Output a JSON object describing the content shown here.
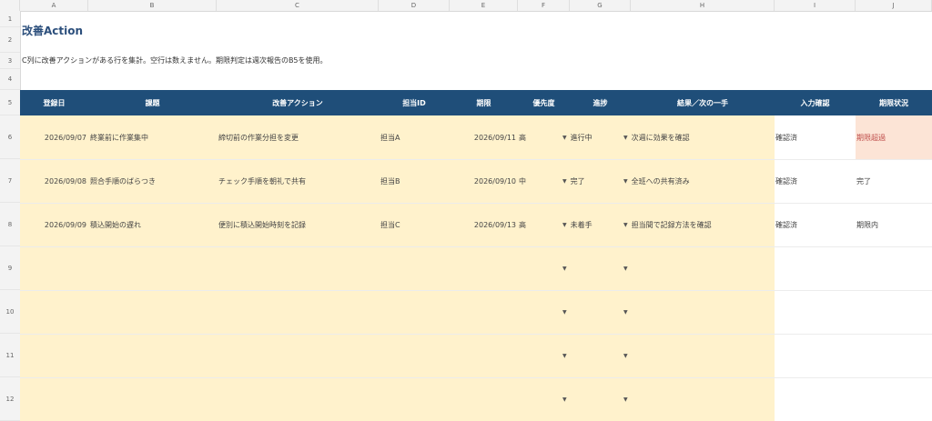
{
  "columns": [
    "A",
    "B",
    "C",
    "D",
    "E",
    "F",
    "G",
    "H",
    "I",
    "J"
  ],
  "rows": [
    "1",
    "2",
    "3",
    "4",
    "5",
    "6",
    "7",
    "8",
    "9",
    "10",
    "11",
    "12"
  ],
  "sheet": {
    "title": "改善Action",
    "note": "C列に改善アクションがある行を集計。空行は数えません。期限判定は週次報告のB5を使用。",
    "headers": [
      "登録日",
      "課題",
      "改善アクション",
      "担当ID",
      "期限",
      "優先度",
      "進捗",
      "結果／次の一手",
      "入力確認",
      "期限状況"
    ],
    "data": [
      {
        "date": "2026/09/07",
        "issue": "終業前に作業集中",
        "action": "締切前の作業分担を変更",
        "owner": "担当A",
        "due": "2026/09/11",
        "priority": "高",
        "progress": "進行中",
        "result": "次週に効果を確認",
        "check": "確認済",
        "status": "期限超過"
      },
      {
        "date": "2026/09/08",
        "issue": "照合手順のばらつき",
        "action": "チェック手順を朝礼で共有",
        "owner": "担当B",
        "due": "2026/09/10",
        "priority": "中",
        "progress": "完了",
        "result": "全班への共有済み",
        "check": "確認済",
        "status": "完了"
      },
      {
        "date": "2026/09/09",
        "issue": "積込開始の遅れ",
        "action": "便別に積込開始時刻を記録",
        "owner": "担当C",
        "due": "2026/09/13",
        "priority": "高",
        "progress": "未着手",
        "result": "担当間で記録方法を確認",
        "check": "確認済",
        "status": "期限内"
      }
    ],
    "dropdown_glyph": "▼"
  },
  "colors": {
    "header_bg": "#1f4e79",
    "input_bg": "#fff2cc",
    "overdue_bg": "#fce4d6",
    "overdue_text": "#c0504d"
  }
}
